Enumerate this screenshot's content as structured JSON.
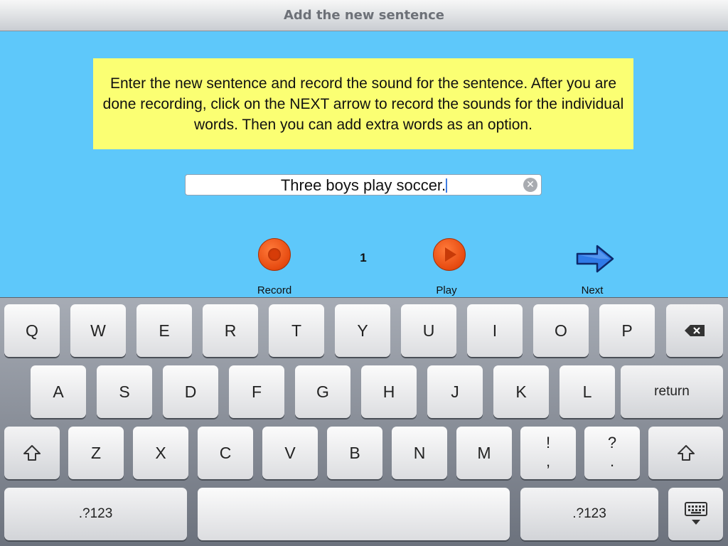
{
  "navbar": {
    "title": "Add the new sentence"
  },
  "instructions": {
    "text": "Enter the new sentence and record the sound for the sentence.  After you are done recording, click on the NEXT arrow to record the sounds for the individual words.  Then you can add extra words as an option."
  },
  "sentence_field": {
    "value": "Three boys play soccer."
  },
  "controls": {
    "record_label": "Record",
    "play_label": "Play",
    "next_label": "Next",
    "counter": "1"
  },
  "keyboard": {
    "row1": [
      "Q",
      "W",
      "E",
      "R",
      "T",
      "Y",
      "U",
      "I",
      "O",
      "P"
    ],
    "row2": [
      "A",
      "S",
      "D",
      "F",
      "G",
      "H",
      "J",
      "K",
      "L"
    ],
    "return_label": "return",
    "row3": [
      "Z",
      "X",
      "C",
      "V",
      "B",
      "N",
      "M"
    ],
    "exclaim_top": "!",
    "exclaim_bottom": ",",
    "question_top": "?",
    "question_bottom": ".",
    "numbers_label": ".?123"
  },
  "icons": {
    "clear": "clear-circle-icon",
    "record": "record-icon",
    "play": "play-icon",
    "next": "arrow-right-icon",
    "backspace": "backspace-icon",
    "shift": "shift-icon",
    "hide_keyboard": "keyboard-dismiss-icon"
  },
  "colors": {
    "background": "#5ec8fa",
    "instructions_bg": "#fbff73",
    "button_orange": "#e64a10",
    "next_arrow": "#2f7be8"
  }
}
